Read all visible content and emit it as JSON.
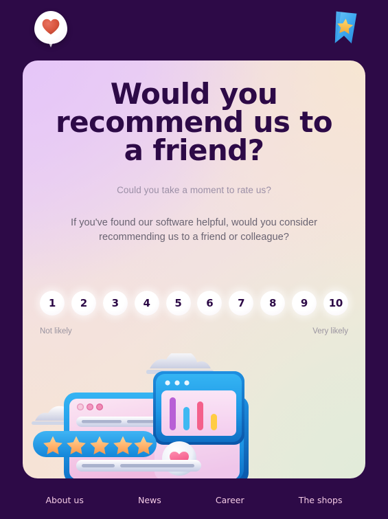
{
  "theme": {
    "background_color": "#2d0a47",
    "card_gradient_start": "#e6c6f8",
    "card_gradient_end": "#e2ebd9",
    "heading_color": "#2d0a47",
    "footer_link_color": "#f2c9e4",
    "accent_blue": "#1ca5ec",
    "star_gold": "#ffb347",
    "heart_pink": "#f4608b"
  },
  "topbar": {
    "logo_icon": "heart-location-pin-icon",
    "bookmark_icon": "bookmark-star-icon"
  },
  "card": {
    "headline": "Would you recommend us to a friend?",
    "subtitle": "Could you take a moment to rate us?",
    "body": "If you've found our software helpful, would you consider recommending us to a friend or colleague?",
    "rating": {
      "options": [
        "1",
        "2",
        "3",
        "4",
        "5",
        "6",
        "7",
        "8",
        "9",
        "10"
      ],
      "low_label": "Not likely",
      "high_label": "Very likely"
    },
    "illustration": {
      "name": "feedback-dashboard-illustration",
      "stars_count": 5,
      "bar_chart_values": [
        100,
        62,
        80,
        42
      ],
      "bar_chart_colors": [
        "#b85fd6",
        "#3fb8f2",
        "#f4608b",
        "#ffcc44"
      ],
      "heart_icon": "heart-icon",
      "clouds": 3
    }
  },
  "footer": {
    "links": [
      {
        "label": "About us"
      },
      {
        "label": "News"
      },
      {
        "label": "Career"
      },
      {
        "label": "The shops"
      }
    ]
  }
}
